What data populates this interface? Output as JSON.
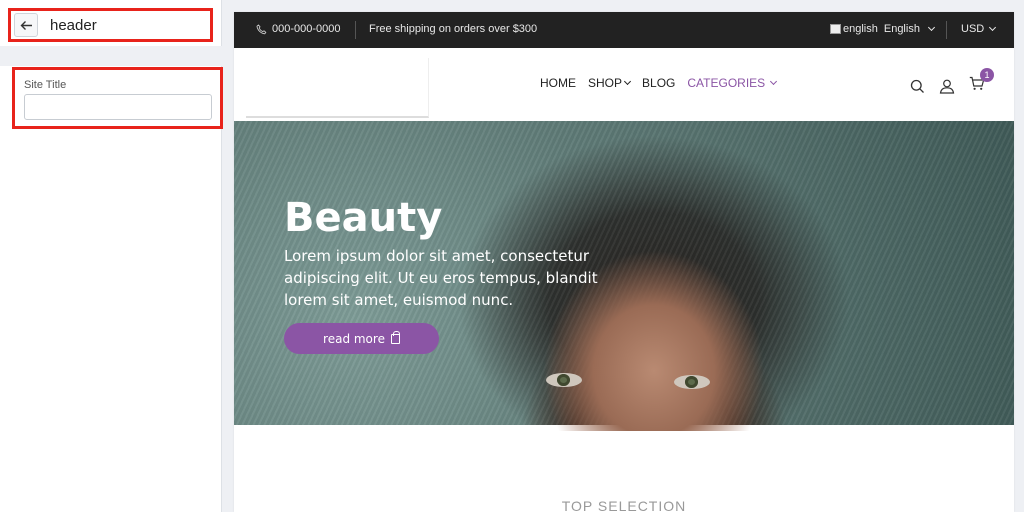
{
  "editor": {
    "section_title": "header",
    "back_icon": "arrow-left-icon",
    "field_label": "Site Title",
    "field_value": ""
  },
  "topbar": {
    "phone_icon": "phone-icon",
    "phone": "000-000-0000",
    "shipping": "Free shipping on orders over $300",
    "lang_img_alt": "english",
    "language": "English",
    "currency": "USD"
  },
  "nav": {
    "links": [
      {
        "label": "HOME"
      },
      {
        "label": "SHOP"
      },
      {
        "label": "BLOG"
      },
      {
        "label": "CATEGORIES"
      }
    ],
    "cart_count": "1"
  },
  "hero": {
    "title": "Beauty",
    "text": "Lorem ipsum dolor sit amet, consectetur adipiscing elit. Ut eu eros tempus, blandit lorem sit amet, euismod nunc.",
    "button": "read more"
  },
  "section": {
    "title": "TOP SELECTION"
  },
  "colors": {
    "accent": "#8b55a5",
    "highlight": "#e8231b",
    "topbar": "#222222"
  }
}
